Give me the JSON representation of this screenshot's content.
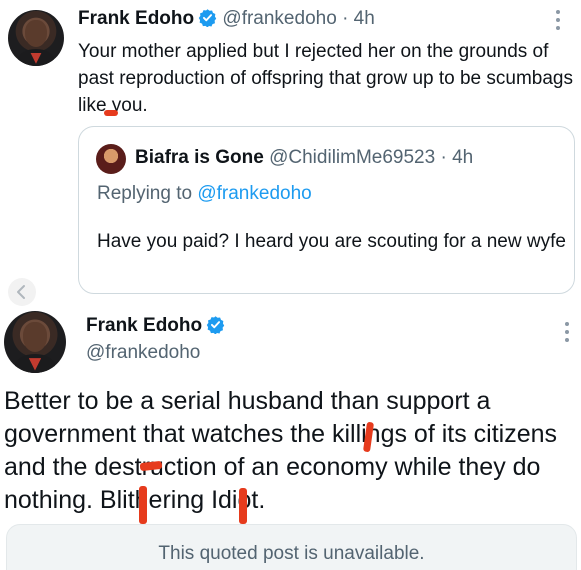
{
  "tweet": {
    "name": "Frank Edoho",
    "handle": "@frankedoho",
    "time": "· 4h",
    "text": "Your mother applied but I rejected her on the grounds of past reproduction of  offspring that grow up to be scumbags like you."
  },
  "quoted": {
    "name": "Biafra is Gone",
    "handle": "@ChidilimMe69523",
    "time": "· 4h",
    "replying_prefix": "Replying to ",
    "replying_handle": "@frankedoho",
    "text": "Have you paid? I heard you are scouting for a new wyfe"
  },
  "tweet2": {
    "name": "Frank Edoho",
    "handle": "@frankedoho",
    "text": "Better to be a serial husband than support a government that watches the killings of its citizens and the destruction of an economy while they do nothing. Blithering Idiot."
  },
  "unavailable": {
    "text": "This quoted post is unavailable."
  },
  "icons": {
    "verified": "verified-badge-icon",
    "more": "more-vertical-icon",
    "back": "chevron-left-icon"
  },
  "colors": {
    "verified": "#1d9bf0",
    "link": "#1d9bf0",
    "secondary_text": "#536471",
    "markup": "#e63b1d"
  }
}
